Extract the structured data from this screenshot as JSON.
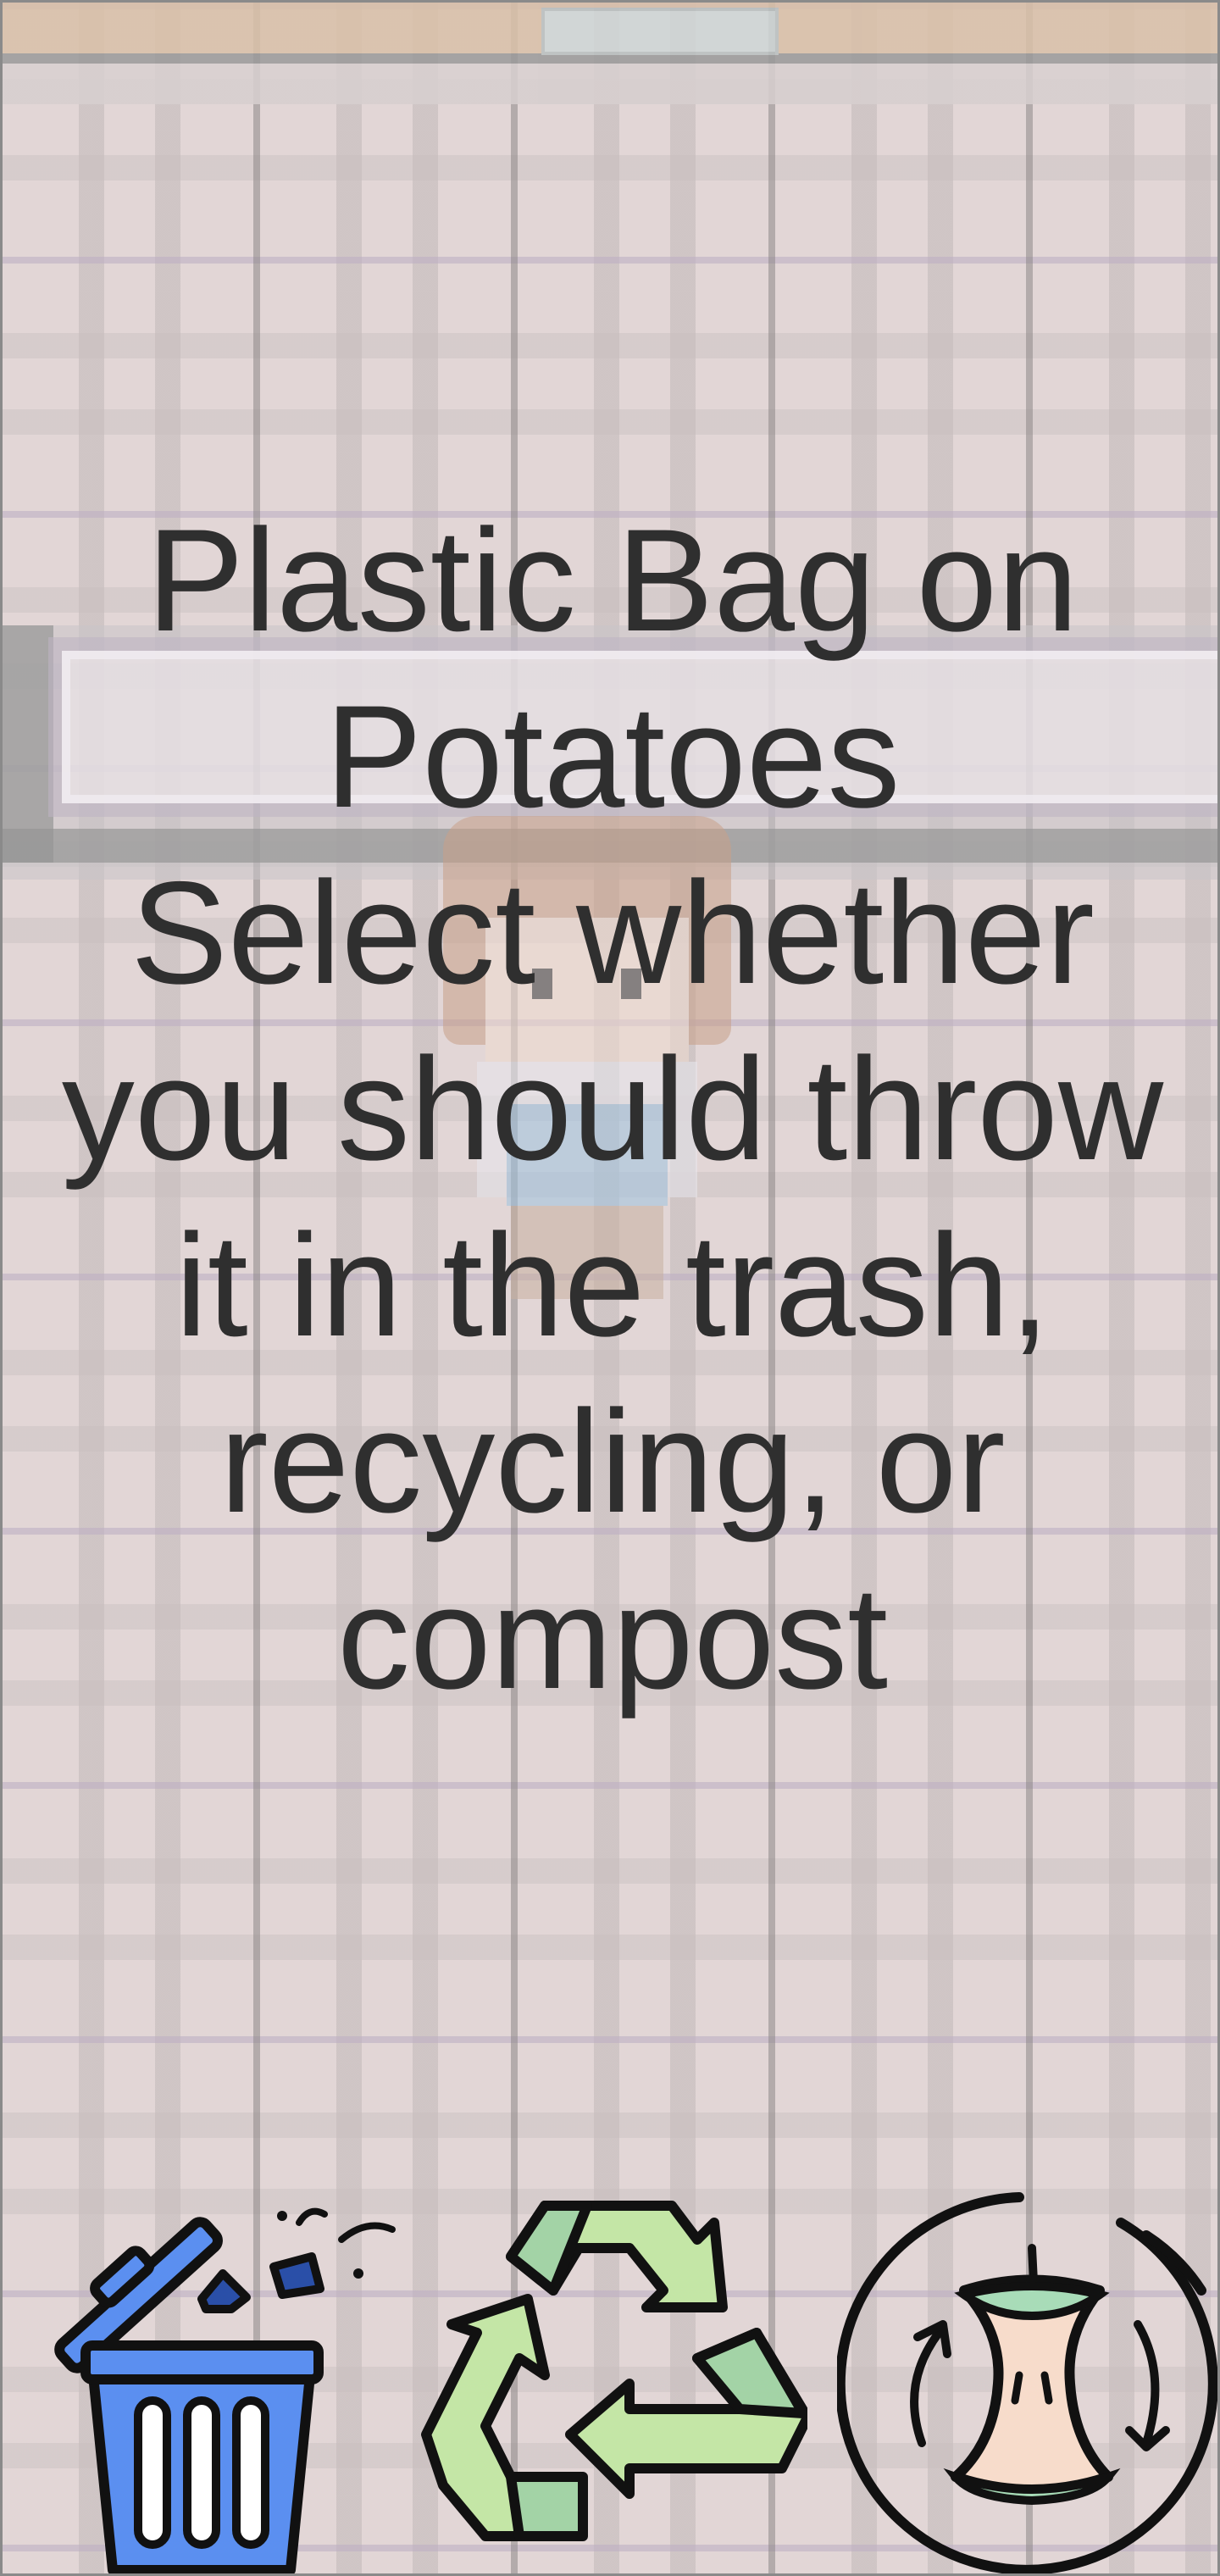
{
  "prompt": {
    "item_name": "Plastic Bag on Potatoes",
    "instruction": "Select whether you should throw it in the trash, recycling, or compost"
  },
  "options": [
    {
      "id": "trash",
      "icon": "trash-bin-icon"
    },
    {
      "id": "recycling",
      "icon": "recycle-arrows-icon"
    },
    {
      "id": "compost",
      "icon": "apple-core-compost-icon"
    }
  ],
  "colors": {
    "text": "#2f2f2f",
    "trash_blue": "#5b8ff0",
    "trash_dark_blue": "#2a4fa8",
    "recycle_light_green": "#c4e6a6",
    "recycle_mid_green": "#a3d3a6",
    "compost_peach": "#f7dccb",
    "compost_green": "#a8dcb8"
  }
}
